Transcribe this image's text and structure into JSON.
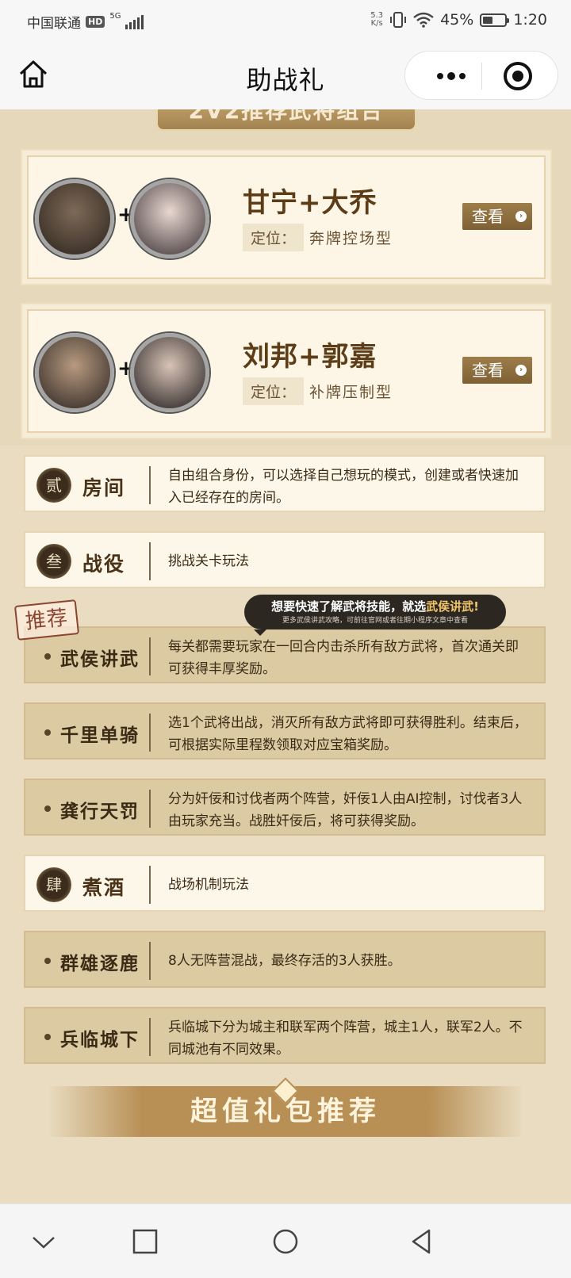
{
  "status_bar": {
    "carrier": "中国联通",
    "hd": "HD",
    "network": "5G",
    "speed_value": "5.3",
    "speed_unit": "K/s",
    "battery": "45%",
    "time": "1:20"
  },
  "nav": {
    "title": "助战礼"
  },
  "section_title": "2V2推荐武将组合",
  "combos": [
    {
      "name": "甘宁+大乔",
      "position_label": "定位：",
      "position": "奔牌控场型",
      "view_label": "查看"
    },
    {
      "name": "刘邦+郭嘉",
      "position_label": "定位：",
      "position": "补牌压制型",
      "view_label": "查看"
    }
  ],
  "modes": [
    {
      "seal": "贰",
      "label": "房间",
      "desc": "自由组合身份，可以选择自己想玩的模式，创建或者快速加入已经存在的房间。"
    },
    {
      "seal": "叁",
      "label": "战役",
      "desc": "挑战关卡玩法"
    },
    {
      "label": "武侯讲武",
      "desc": "每关都需要玩家在一回合内击杀所有敌方武将，首次通关即可获得丰厚奖励。"
    },
    {
      "label": "千里单骑",
      "desc": "选1个武将出战，消灭所有敌方武将即可获得胜利。结束后，可根据实际里程数领取对应宝箱奖励。"
    },
    {
      "label": "龚行天罚",
      "desc": "分为奸佞和讨伐者两个阵营，奸佞1人由AI控制，讨伐者3人由玩家充当。战胜奸佞后，将可获得奖励。"
    },
    {
      "seal": "肆",
      "label": "煮酒",
      "desc": "战场机制玩法"
    },
    {
      "label": "群雄逐鹿",
      "desc": "8人无阵营混战，最终存活的3人获胜。"
    },
    {
      "label": "兵临城下",
      "desc": "兵临城下分为城主和联军两个阵营，城主1人，联军2人。不同城池有不同效果。"
    }
  ],
  "recommend_stamp": "推荐",
  "tooltip": {
    "text_before": "想要快速了解武将技能，就选",
    "highlight": "武侯讲武!",
    "subtext": "更多武侯讲武攻略，可前往官网或者往期小程序文章中查看"
  },
  "gift_banner": "超值礼包推荐",
  "colors": {
    "accent_brown": "#9d7d4a",
    "background": "#e9dcc0",
    "highlight_gold": "#f2c66a"
  }
}
